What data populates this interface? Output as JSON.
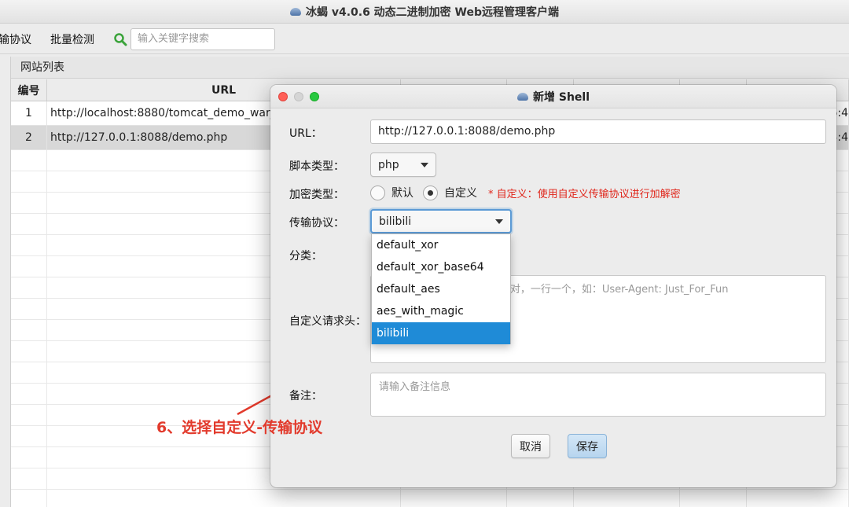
{
  "window": {
    "title": "冰蝎 v4.0.6 动态二进制加密 Web远程管理客户端"
  },
  "toolbar": {
    "menu_protocol": "输协议",
    "menu_batch_check": "批量检测",
    "search_placeholder": "输入关键字搜索"
  },
  "site_list": {
    "title": "网站列表",
    "columns": [
      "编号",
      "URL",
      "",
      "",
      "",
      "",
      ""
    ],
    "rows": [
      {
        "id": "1",
        "url": "http://localhost:8880/tomcat_demo_war_ex",
        "tail": "6:4"
      },
      {
        "id": "2",
        "url": "http://127.0.0.1:8088/demo.php",
        "tail": "3:4"
      }
    ]
  },
  "dialog": {
    "title": "新增 Shell",
    "url_label": "URL：",
    "url_value": "http://127.0.0.1:8088/demo.php",
    "script_type_label": "脚本类型：",
    "script_type_value": "php",
    "encrypt_type_label": "加密类型：",
    "encrypt_default": "默认",
    "encrypt_custom": "自定义",
    "encrypt_hint": "* 自定义：使用自定义传输协议进行加解密",
    "protocol_label": "传输协议：",
    "protocol_value": "bilibili",
    "category_label": "分类：",
    "headers_label": "自定义请求头：",
    "headers_placeholder": "alue对，一行一个，如：User-Agent: Just_For_Fun",
    "notes_label": "备注：",
    "notes_placeholder": "请输入备注信息",
    "cancel_label": "取消",
    "save_label": "保存"
  },
  "protocol_dropdown": {
    "options": [
      "default_xor",
      "default_xor_base64",
      "default_aes",
      "aes_with_magic",
      "bilibili"
    ],
    "selected": "bilibili"
  },
  "annotation": {
    "text": "6、选择自定义-传输协议",
    "color": "#e23a2c"
  }
}
